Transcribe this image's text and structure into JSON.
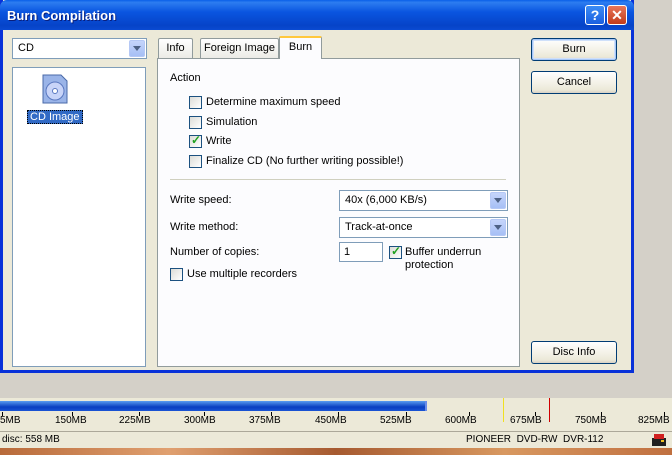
{
  "window": {
    "title": "Burn Compilation",
    "help_glyph": "?",
    "close_glyph": "✕"
  },
  "left": {
    "type_select": "CD",
    "list_item": "CD Image"
  },
  "tabs": [
    {
      "label": "Info"
    },
    {
      "label": "Foreign Image"
    },
    {
      "label": "Burn"
    }
  ],
  "burn_tab": {
    "action_label": "Action",
    "options": [
      {
        "label": "Determine maximum speed",
        "checked": false
      },
      {
        "label": "Simulation",
        "checked": false
      },
      {
        "label": "Write",
        "checked": true
      },
      {
        "label": "Finalize CD (No further writing possible!)",
        "checked": false
      }
    ],
    "write_speed_label": "Write speed:",
    "write_speed_value": "40x (6,000 KB/s)",
    "write_method_label": "Write method:",
    "write_method_value": "Track-at-once",
    "copies_label": "Number of copies:",
    "copies_value": "1",
    "buffer_label_1": "Buffer underrun",
    "buffer_label_2": "protection",
    "buffer_checked": true,
    "multiple_recorders_label": "Use multiple recorders",
    "multiple_recorders_checked": false
  },
  "buttons": {
    "burn": "Burn",
    "cancel": "Cancel",
    "disc_info": "Disc Info"
  },
  "capacity": {
    "fill_mb": 558,
    "ticks": [
      "5MB",
      "150MB",
      "225MB",
      "300MB",
      "375MB",
      "450MB",
      "525MB",
      "600MB",
      "675MB",
      "750MB",
      "825MB"
    ],
    "colors": {
      "fill": "#0a3ec0",
      "marker_yellow": "#f0e020",
      "marker_red": "#d00000"
    }
  },
  "status": {
    "disc": "disc: 558 MB",
    "drive": "PIONEER  DVD-RW  DVR-112"
  },
  "icons": [
    "help-icon",
    "close-icon",
    "cd-image-icon",
    "chevron-down-icon",
    "checkmark-icon",
    "drive-status-icon"
  ]
}
